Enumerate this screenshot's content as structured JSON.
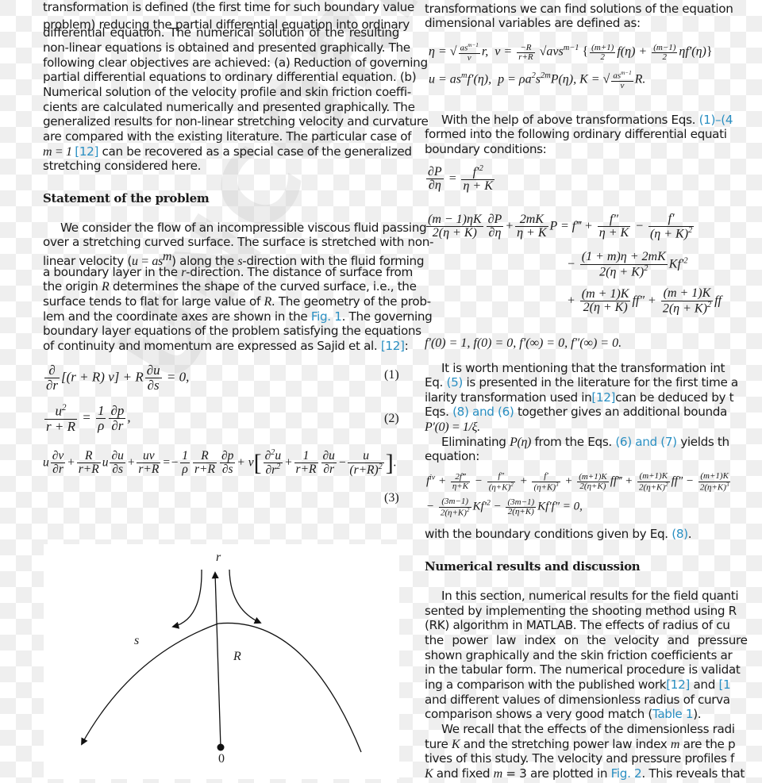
{
  "left_column": {
    "intro_lines": [
      "transformation is defined (the first time for such boundary value",
      "problem) reducing the partial differential equation into ordinary",
      "differential equation. The numerical solution of the resulting",
      "non-linear equations is obtained and presented graphically. The",
      "following clear objectives are achieved: (a) Reduction of governing",
      "partial differential equations to ordinary differential equation. (b)",
      "Numerical solution of the velocity profile and skin friction coeffi-",
      "cients are calculated numerically and presented graphically. The",
      "generalized results for non-linear stretching velocity and curvature",
      "are compared with the existing literature. The particular case of"
    ],
    "intro_m_prefix": "m = 1 ",
    "intro_ref": "[12]",
    "intro_m_suffix": " can be recovered as a special case of the generalized",
    "intro_last": "stretching considered here.",
    "section_heading": "Statement of the problem",
    "problem_lines": {
      "l1": "We consider the flow of an incompressible viscous fluid passing",
      "l2": "over a stretching curved surface. The surface is stretched with non-",
      "l3a": "linear velocity (",
      "l3_math": "u = as",
      "l3_sup": "m",
      "l3b": ") along the ",
      "l3_s": "s",
      "l3c": "-direction with the fluid forming",
      "l4a": "a boundary layer in the ",
      "l4_r": "r",
      "l4b": "-direction. The distance of surface from",
      "l5a": "the origin ",
      "l5_R": "R",
      "l5b": " determines the shape of the curved surface, i.e., the",
      "l6a": "surface tends to flat for large value of ",
      "l6_R": "R",
      "l6b": ". The geometry of the prob-",
      "l7a": "lem and the coordinate axes are shown in the ",
      "l7_link": "Fig. 1",
      "l7b": ". The governing",
      "l8": "boundary layer equations of the problem satisfying the equations",
      "l9a": "of continuity and momentum are expressed as Sajid et al. ",
      "l9_link": "[12]",
      "l9b": ":"
    },
    "equations": {
      "eq1_number": "(1)",
      "eq2_number": "(2)",
      "eq3_number": "(3)"
    }
  },
  "right_column": {
    "top_line1": "transformations we can find solutions of the equation",
    "top_line2": "dimensional variables are defined as:",
    "para2_line1a": "With the help of above transformations Eqs. ",
    "para2_line1_link": "(1)–(4",
    "para2_line2": "formed into the following ordinary differential equati",
    "para2_line3": "boundary conditions:",
    "bc_line": "f′(0) = 1, f(0) = 0, f′(∞) = 0, f″(∞) = 0.",
    "para3_line1": "It is worth mentioning that the transformation int",
    "para3_line2a": "Eq. ",
    "para3_line2_link": "(5)",
    "para3_line2b": " is presented in the literature for the first time a",
    "para3_line3a": "ilarity transformation used in",
    "para3_line3_link": "[12]",
    "para3_line3b": "can be deduced by t",
    "para3_line4a": "Eqs. ",
    "para3_line4_link": "(8) and (6)",
    "para3_line4b": " together gives an additional bounda",
    "para3_line5": "P′(0) = 1/ξ.",
    "para4_line1a": "Eliminating ",
    "para4_line1_math": "P(η)",
    "para4_line1b": " from the Eqs. ",
    "para4_line1_link": "(6) and (7)",
    "para4_line1c": " yields th",
    "para4_line2": "equation:",
    "after_eq_a": "with the boundary conditions given by Eq. ",
    "after_eq_link": "(8)",
    "after_eq_b": ".",
    "section_heading": "Numerical results and discussion",
    "results_lines": {
      "l1": "In this section, numerical results for the field quanti",
      "l2": "sented by implementing the shooting method using R",
      "l3": "(RK) algorithm in MATLAB. The effects of radius of cu",
      "l4": "the power law index on the velocity and pressure",
      "l5": "shown graphically and the skin friction coefficients ar",
      "l6": "in the tabular form. The numerical procedure is validat",
      "l7a": "ing a comparison with the published work",
      "l7_link1": "[12]",
      "l7b": " and ",
      "l7_link2": "[1",
      "l8": "and different values of dimensionless radius of curva",
      "l9a": "comparison shows a very good match (",
      "l9_link": "Table 1",
      "l9b": ").",
      "l10": "We recall that the effects of the dimensionless radi",
      "l11a": "ture ",
      "l11_K": "K",
      "l11b": " and the stretching power law index ",
      "l11_m": "m",
      "l11c": " are the p",
      "l12": "tives of this study. The velocity and pressure profiles f",
      "l13a": "K",
      "l13b": " and fixed ",
      "l13_m": "m",
      "l13c": " = 3 are plotted in ",
      "l13_link": "Fig. 2",
      "l13d": ". This reveals that"
    }
  },
  "figure": {
    "label_r": "r",
    "label_s": "s",
    "label_R": "R",
    "label_origin": "0"
  },
  "watermark": "UNCORRECTED PROOF",
  "colors": {
    "link": "#2a8fc2",
    "text": "#1a1a1a",
    "checker_light": "#ffffff",
    "checker_dark": "#efefef"
  }
}
